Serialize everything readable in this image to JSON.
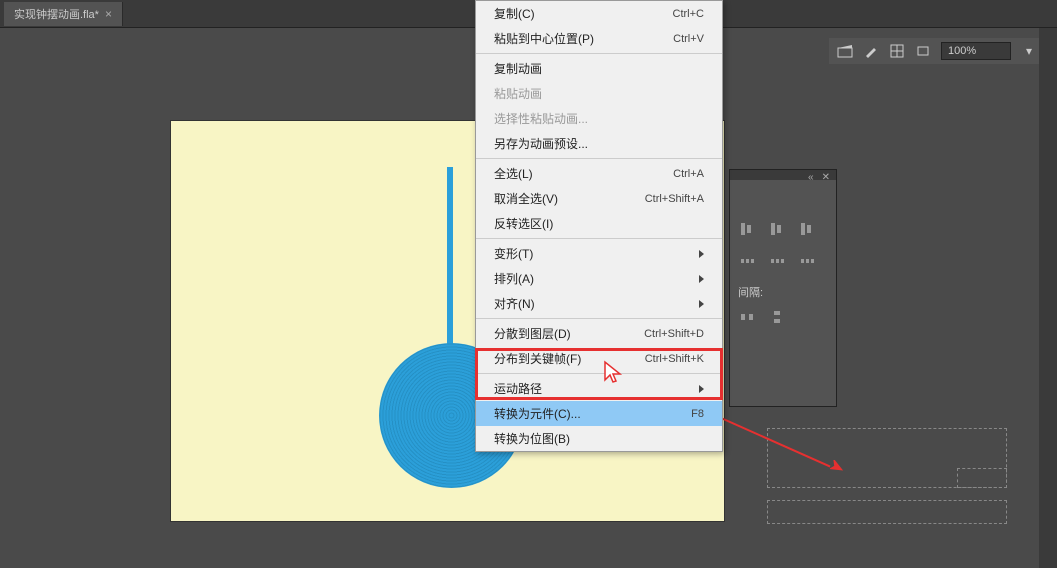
{
  "tab": {
    "title": "实现钟摆动画.fla*",
    "close": "×"
  },
  "toolbar": {
    "zoom": "100%"
  },
  "panel": {
    "collapse_icon": "«",
    "close_icon": "✕",
    "gap_label": "间隔:"
  },
  "context_menu": {
    "items": [
      {
        "label": "复制(C)",
        "shortcut": "Ctrl+C",
        "disabled": false
      },
      {
        "label": "粘贴到中心位置(P)",
        "shortcut": "Ctrl+V",
        "disabled": false
      },
      {
        "sep": true
      },
      {
        "label": "复制动画",
        "disabled": false
      },
      {
        "label": "粘贴动画",
        "disabled": true
      },
      {
        "label": "选择性粘贴动画...",
        "disabled": true
      },
      {
        "label": "另存为动画预设...",
        "disabled": false
      },
      {
        "sep": true
      },
      {
        "label": "全选(L)",
        "shortcut": "Ctrl+A"
      },
      {
        "label": "取消全选(V)",
        "shortcut": "Ctrl+Shift+A"
      },
      {
        "label": "反转选区(I)"
      },
      {
        "sep": true
      },
      {
        "label": "变形(T)",
        "submenu": true
      },
      {
        "label": "排列(A)",
        "submenu": true
      },
      {
        "label": "对齐(N)",
        "submenu": true
      },
      {
        "sep": true
      },
      {
        "label": "分散到图层(D)",
        "shortcut": "Ctrl+Shift+D"
      },
      {
        "label": "分布到关键帧(F)",
        "shortcut": "Ctrl+Shift+K"
      },
      {
        "sep": true
      },
      {
        "label": "运动路径",
        "submenu": true
      },
      {
        "label": "转换为元件(C)...",
        "shortcut": "F8",
        "selected": true
      },
      {
        "label": "转换为位图(B)"
      }
    ]
  }
}
